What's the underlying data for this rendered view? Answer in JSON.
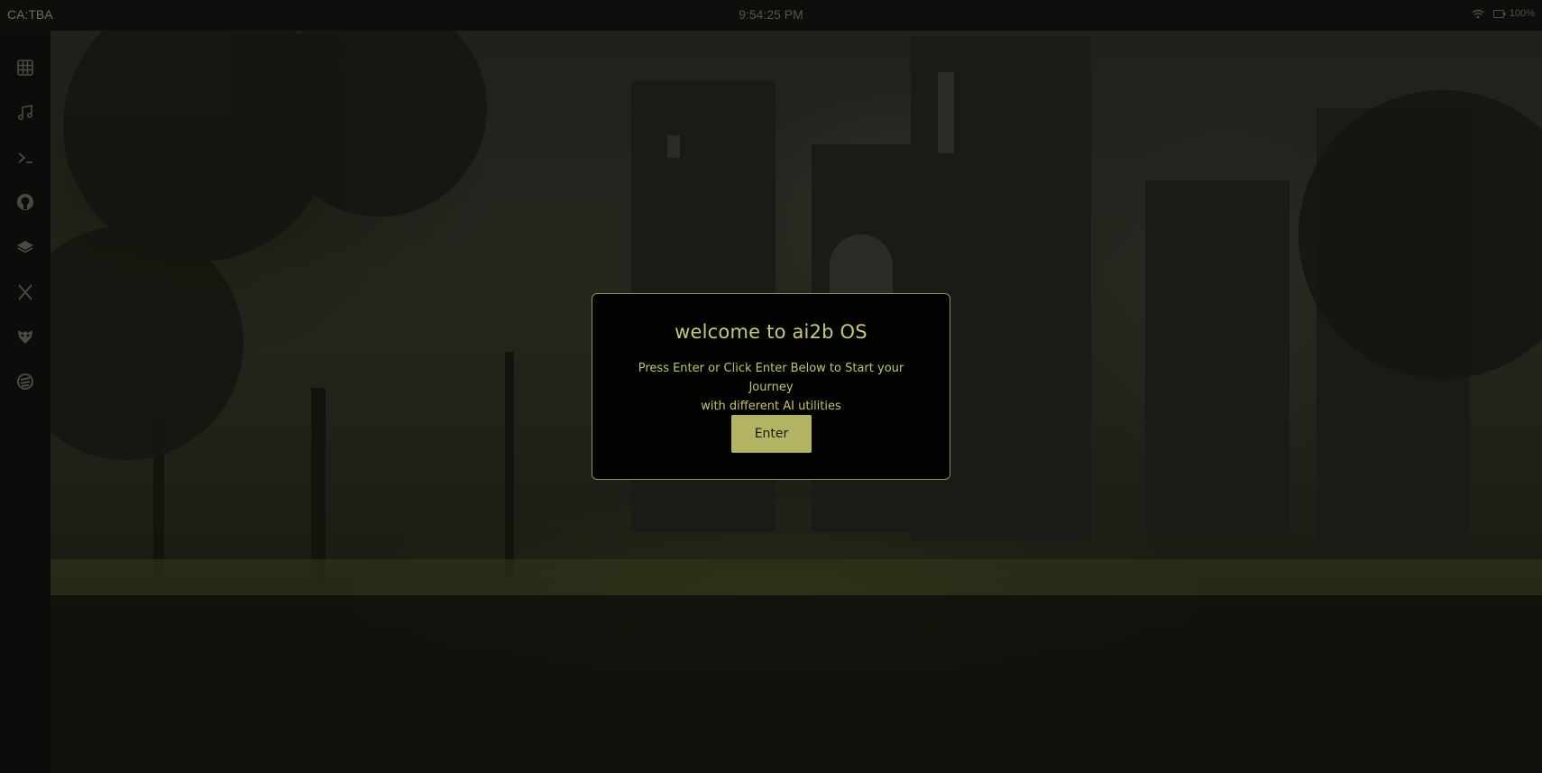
{
  "topbar": {
    "contract": "CA:TBA",
    "clock": "9:54:25 PM",
    "battery": "100%",
    "icons": [
      "wifi-icon",
      "battery-icon"
    ]
  },
  "dock": {
    "items": [
      {
        "icon": "grid-icon"
      },
      {
        "icon": "music-note-icon"
      },
      {
        "icon": "terminal-icon"
      },
      {
        "icon": "github-icon"
      },
      {
        "icon": "layers-icon"
      },
      {
        "icon": "x-logo-icon"
      },
      {
        "icon": "owl-icon"
      },
      {
        "icon": "stack-logo-icon"
      }
    ]
  },
  "modal": {
    "title": "welcome to ai2b OS",
    "text_line1": "Press Enter or Click Enter Below to Start your Journey",
    "text_line2": "with different AI utilities",
    "enter_label": "Enter"
  },
  "colors": {
    "accent": "#b3b463",
    "accent_text": "#c8ca6e",
    "modal_border": "#8f9150",
    "modal_bg": "#020201"
  }
}
